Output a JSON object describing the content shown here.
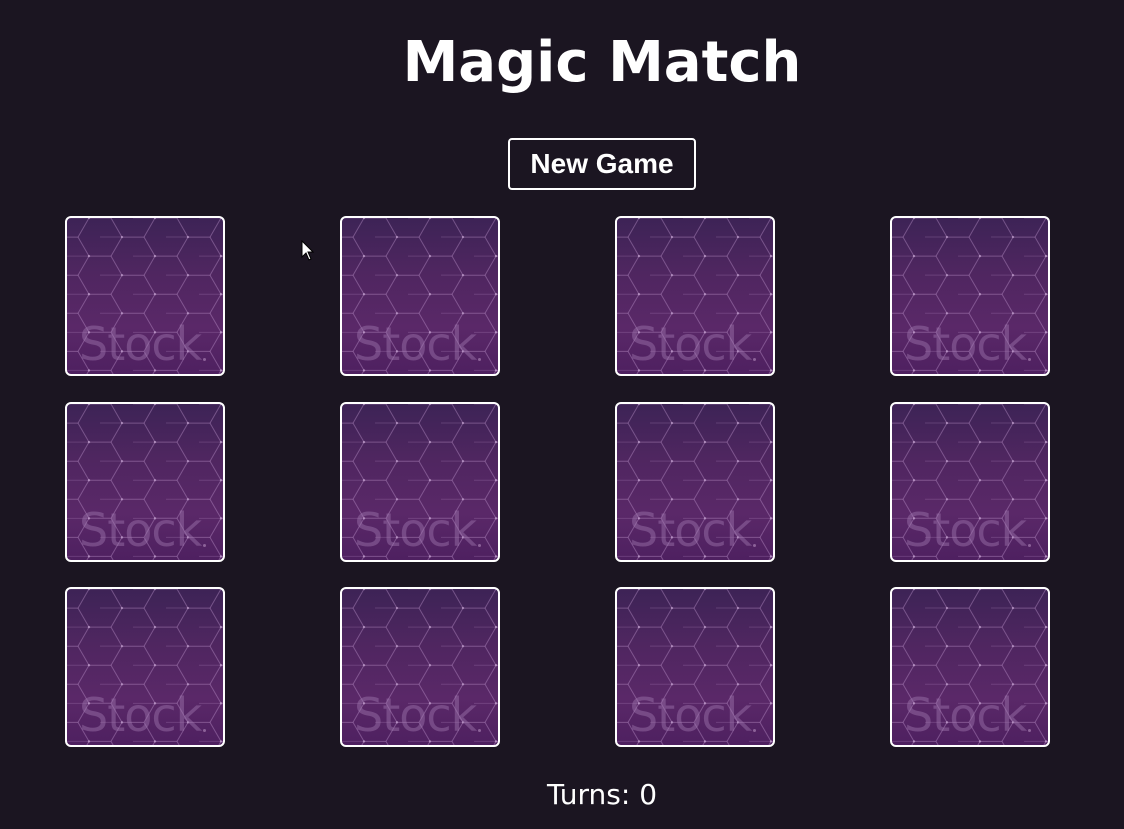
{
  "game": {
    "title": "Magic Match",
    "new_game_label": "New Game",
    "turns_label": "Turns: 0",
    "turns": 0
  },
  "cards": [
    {
      "watermark": "Stock",
      "state": "face-down"
    },
    {
      "watermark": "Stock",
      "state": "face-down"
    },
    {
      "watermark": "Stock",
      "state": "face-down"
    },
    {
      "watermark": "Stock",
      "state": "face-down"
    },
    {
      "watermark": "Stock",
      "state": "face-down"
    },
    {
      "watermark": "Stock",
      "state": "face-down"
    },
    {
      "watermark": "Stock",
      "state": "face-down"
    },
    {
      "watermark": "Stock",
      "state": "face-down"
    },
    {
      "watermark": "Stock",
      "state": "face-down"
    },
    {
      "watermark": "Stock",
      "state": "face-down"
    },
    {
      "watermark": "Stock",
      "state": "face-down"
    },
    {
      "watermark": "Stock",
      "state": "face-down"
    }
  ],
  "colors": {
    "background": "#1b1521",
    "card_back": "#4f2660",
    "border": "#ffffff"
  },
  "icons": {
    "cursor": "mouse-pointer-icon"
  }
}
